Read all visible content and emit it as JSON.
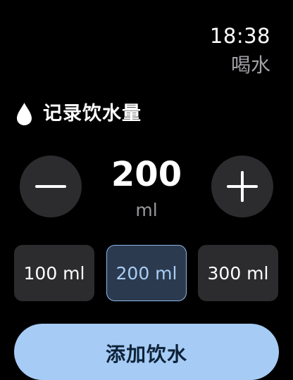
{
  "status": {
    "time": "18:38"
  },
  "app": {
    "title": "喝水"
  },
  "section": {
    "icon": "water-drop-icon",
    "title": "记录饮水量"
  },
  "amount": {
    "value": "200",
    "unit": "ml",
    "decrease_icon": "minus-icon",
    "increase_icon": "plus-icon"
  },
  "presets": [
    {
      "label": "100 ml",
      "selected": false
    },
    {
      "label": "200 ml",
      "selected": true
    },
    {
      "label": "300 ml",
      "selected": false
    }
  ],
  "actions": {
    "add_label": "添加饮水"
  },
  "colors": {
    "background": "#000000",
    "control_surface": "#2c2c2e",
    "accent": "#a6ccf5",
    "selected_fill": "#2b3a4e",
    "selected_border": "#8cb8e8",
    "secondary_text": "#98989d"
  }
}
